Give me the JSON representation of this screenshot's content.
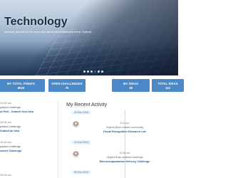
{
  "hero": {
    "title": "Technology",
    "subtitle": "olutions, and we're the ones who would and implement them.  Submit",
    "slider_dots": 6,
    "active_dot": 4
  },
  "stats": [
    {
      "label": "MY TOTAL POINTS",
      "value": "6020"
    },
    {
      "label": "OPEN CHALLENGES",
      "value": "75"
    },
    {
      "label": "MY IDEAS",
      "value": "38"
    },
    {
      "label": "TOTAL IDEAS",
      "value": "112"
    }
  ],
  "left_feed": [
    {
      "time": "10:35 am",
      "text": "pdated challenge",
      "link": "ut Pole - Submit Your Idea"
    },
    {
      "time": "10:35 am",
      "text": "pdated challenge",
      "link": "Submit an Idea"
    },
    {
      "time": "10:35 am",
      "text": "pdated challenge",
      "link": "ssmer Challenge"
    },
    {
      "time": "10:35 am",
      "text": "",
      "link": ""
    }
  ],
  "activity": {
    "title": "My Recent Activity",
    "entries": [
      {
        "date": "20 Dec 2019",
        "time": "8:11 pm",
        "text": "Virginia Bush created community",
        "link": "Facial Recognition Research Lab"
      },
      {
        "date": "12 Dec 2019",
        "time": "10:35 am",
        "text": "Virginia Bush updated challenge",
        "link": "Microencapsulation Delivery Challenge"
      },
      {
        "date": "09 Dec 2019",
        "time": "",
        "text": "",
        "link": ""
      }
    ]
  },
  "colors": {
    "stat_bg": "#4a88c8",
    "link": "#1e5aa8",
    "title": "#1f2d3d"
  }
}
